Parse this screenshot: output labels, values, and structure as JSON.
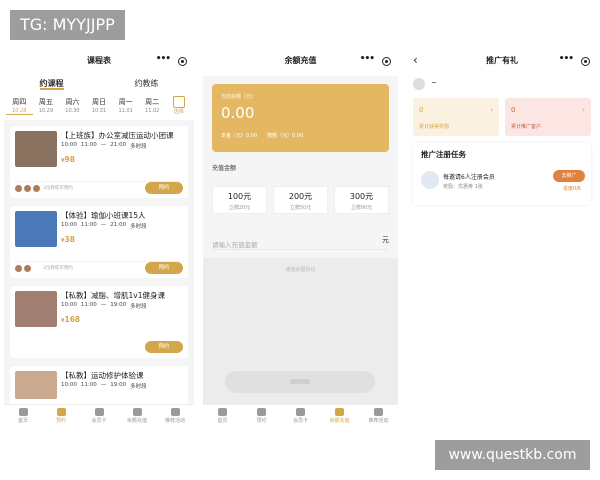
{
  "watermarks": {
    "top_left": "TG: MYYJJPP",
    "bottom_right": "www.questkb.com"
  },
  "tabbar": [
    "首页",
    "预约",
    "会员卡",
    "余额充值",
    "推荐活动"
  ],
  "schedule": {
    "title": "课程表",
    "tabs": [
      "约课程",
      "约教练"
    ],
    "days": [
      {
        "name": "周四",
        "date": "10.28"
      },
      {
        "name": "周五",
        "date": "10.29"
      },
      {
        "name": "周六",
        "date": "10.30"
      },
      {
        "name": "周日",
        "date": "10.31"
      },
      {
        "name": "周一",
        "date": "11.01"
      },
      {
        "name": "周二",
        "date": "11.02"
      }
    ],
    "calendar_label": "选择",
    "courses": [
      {
        "title": "【上班族】办公室减压运动小团课",
        "time": [
          "10:00",
          "11:00",
          "—",
          "21:00",
          "多时段"
        ],
        "price": "98",
        "note": "3位教练可预约",
        "button": "预约"
      },
      {
        "title": "【体验】瑜伽小班课15人",
        "time": [
          "10:00",
          "11:00",
          "—",
          "21:00",
          "多时段"
        ],
        "price": "38",
        "note": "2位教练可预约",
        "button": "预约"
      },
      {
        "title": "【私教】减脂、增肌1v1健身课",
        "time": [
          "10:00",
          "11:00",
          "—",
          "19:00",
          "多时段"
        ],
        "price": "168",
        "note": "",
        "button": "预约"
      },
      {
        "title": "【私教】运动修护体验课",
        "time": [
          "10:00",
          "11:00",
          "—",
          "19:00",
          "多时段"
        ],
        "price": "",
        "note": "",
        "button": ""
      }
    ]
  },
  "recharge": {
    "title": "余额充值",
    "balance_label": "当前余额（元）",
    "balance": "0.00",
    "principal": "本金（元）0.00",
    "gift": "赠额（元）0.00",
    "amount_title": "充值金额",
    "amounts": [
      {
        "value": "100元",
        "gift": "立赠20元"
      },
      {
        "value": "200元",
        "gift": "立赠50元"
      },
      {
        "value": "300元",
        "gift": "立赠90元"
      }
    ],
    "input_placeholder": "请输入充值金额",
    "input_unit": "元",
    "agreement_title": "储值余额协议"
  },
  "promo": {
    "title": "推广有礼",
    "user_name": "~",
    "stats": [
      {
        "value": "0",
        "label": "累计获得奖励"
      },
      {
        "value": "0",
        "label": "累计推广客户"
      }
    ],
    "task_title": "推广注册任务",
    "task_name": "每邀请6人注册会员",
    "task_reward": "奖励：优惠券 1张",
    "task_button": "去推广",
    "task_progress": "进度0/6"
  },
  "colors": {
    "accent": "#d4a64a",
    "orange": "#e0813f"
  }
}
